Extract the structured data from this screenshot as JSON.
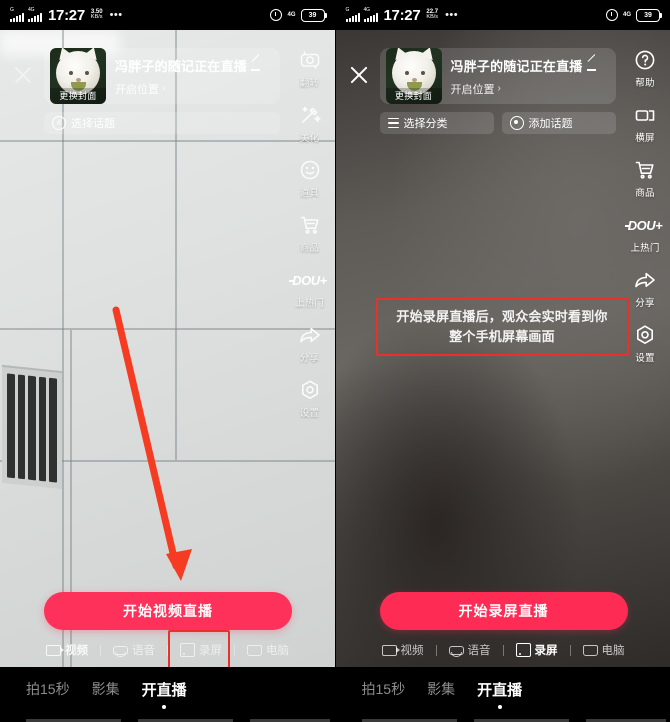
{
  "meta": {
    "app": "douyin-live-setup",
    "accent_pink": "#fe2c55",
    "annotation_red": "#e8312a"
  },
  "panels": [
    {
      "id": "left",
      "variant": "video-live",
      "status_bar": {
        "carrier_label": "G",
        "network_label": "4G",
        "network_sup": "HD",
        "time": "17:27",
        "speed_value": "3.50",
        "speed_unit": "KB/s",
        "overflow": "•••",
        "alarm_icon": "alarm-clock-icon",
        "net_icon": "4G",
        "battery": "39"
      },
      "close_icon": "close-icon",
      "card": {
        "cover_tag": "更换封面",
        "title": "冯胖子的随记正在直播",
        "edit_icon": "pencil-icon",
        "location": "开启位置",
        "chevron": "›"
      },
      "chips": [
        {
          "icon": "hash-icon",
          "label": "选择话题"
        }
      ],
      "rail": [
        {
          "icon": "flip-camera-icon",
          "label": "翻转"
        },
        {
          "icon": "magic-wand-icon",
          "label": "美化"
        },
        {
          "icon": "smiley-face-icon",
          "label": "道具"
        },
        {
          "icon": "shopping-cart-icon",
          "label": "商品"
        },
        {
          "icon": "dou-plus-icon",
          "label": "上热门",
          "wordmark": "DOU+"
        },
        {
          "icon": "share-arrow-icon",
          "label": "分享"
        },
        {
          "icon": "settings-gear-icon",
          "label": "设置"
        }
      ],
      "annotation": null,
      "arrow": {
        "name": "red-pointer-arrow",
        "color": "#f53c22"
      },
      "cta": "开始视频直播",
      "modes": [
        {
          "label": "视频",
          "icon": "video-camera-icon",
          "active": true
        },
        {
          "label": "语音",
          "icon": "microphone-icon",
          "active": false
        },
        {
          "label": "录屏",
          "icon": "phone-screen-icon",
          "active": false,
          "highlighted": true
        },
        {
          "label": "电脑",
          "icon": "computer-icon",
          "active": false
        }
      ],
      "bottom_nav": [
        {
          "label": "拍15秒",
          "active": false
        },
        {
          "label": "影集",
          "active": false
        },
        {
          "label": "开直播",
          "active": true
        }
      ]
    },
    {
      "id": "right",
      "variant": "screen-record-live",
      "status_bar": {
        "carrier_label": "G",
        "network_label": "4G",
        "network_sup": "HD",
        "time": "17:27",
        "speed_value": "22.7",
        "speed_unit": "KB/s",
        "overflow": "•••",
        "alarm_icon": "alarm-clock-icon",
        "net_icon": "4G",
        "battery": "39"
      },
      "close_icon": "close-icon",
      "card": {
        "cover_tag": "更换封面",
        "title": "冯胖子的随记正在直播",
        "edit_icon": "pencil-icon",
        "location": "开启位置",
        "chevron": "›"
      },
      "chips": [
        {
          "icon": "list-icon",
          "label": "选择分类"
        },
        {
          "icon": "target-icon",
          "label": "添加话题"
        }
      ],
      "rail": [
        {
          "icon": "help-question-icon",
          "label": "帮助"
        },
        {
          "icon": "landscape-screen-icon",
          "label": "横屏"
        },
        {
          "icon": "shopping-cart-icon",
          "label": "商品"
        },
        {
          "icon": "dou-plus-icon",
          "label": "上热门",
          "wordmark": "DOU+"
        },
        {
          "icon": "share-arrow-icon",
          "label": "分享"
        },
        {
          "icon": "settings-gear-icon",
          "label": "设置"
        }
      ],
      "annotation": {
        "line1": "开始录屏直播后，观众会实时看到你",
        "line2": "整个手机屏幕画面"
      },
      "arrow": null,
      "cta": "开始录屏直播",
      "modes": [
        {
          "label": "视频",
          "icon": "video-camera-icon",
          "active": false
        },
        {
          "label": "语音",
          "icon": "microphone-icon",
          "active": false
        },
        {
          "label": "录屏",
          "icon": "phone-screen-icon",
          "active": true
        },
        {
          "label": "电脑",
          "icon": "computer-icon",
          "active": false
        }
      ],
      "bottom_nav": [
        {
          "label": "拍15秒",
          "active": false
        },
        {
          "label": "影集",
          "active": false
        },
        {
          "label": "开直播",
          "active": true
        }
      ]
    }
  ]
}
